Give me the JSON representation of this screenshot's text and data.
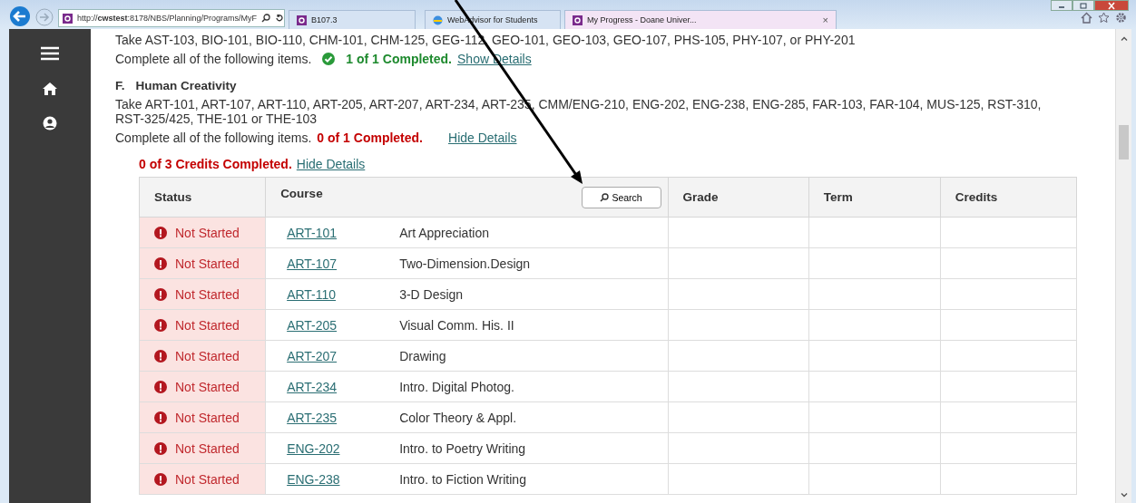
{
  "browser": {
    "url": "http://**cwstest**:8178/NBS/Planning/Programs/MyF",
    "tabs": [
      {
        "label": "B107.3",
        "selected": false
      },
      {
        "label": "WebAdvisor for Students",
        "selected": false
      },
      {
        "label": "My Progress - Doane Univer...",
        "selected": true,
        "close": "×"
      }
    ]
  },
  "previous_requirement": {
    "description": "Take AST-103, BIO-101, BIO-110, CHM-101, CHM-125, GEG-112, GEO-101, GEO-103, GEO-107, PHS-105, PHY-107, or PHY-201",
    "instruction": "Complete all of the following items.",
    "completed": true,
    "progress": "1 of 1 Completed.",
    "link": "Show Details"
  },
  "section": {
    "letter": "F.",
    "title": "Human Creativity",
    "description": "Take ART-101, ART-107, ART-110, ART-205, ART-207, ART-234, ART-235, CMM/ENG-210, ENG-202, ENG-238, ENG-285, FAR-103, FAR-104, MUS-125, RST-310, RST-325/425, THE-101 or THE-103",
    "instruction": "Complete all of the following items.",
    "completed": false,
    "progress": "0 of 1 Completed.",
    "link": "Hide Details"
  },
  "group": {
    "completed": false,
    "progress": "0 of 3 Credits Completed.",
    "link": "Hide Details"
  },
  "table": {
    "columns": [
      {
        "label": "Status"
      },
      {
        "label": "Course",
        "search_button": "Search"
      },
      {
        "label": "Grade"
      },
      {
        "label": "Term"
      },
      {
        "label": "Credits"
      }
    ],
    "rows": [
      {
        "status": "Not Started",
        "completed": false,
        "code": "ART-101",
        "title": "Art Appreciation"
      },
      {
        "status": "Not Started",
        "completed": false,
        "code": "ART-107",
        "title": "Two-Dimension.Design"
      },
      {
        "status": "Not Started",
        "completed": false,
        "code": "ART-110",
        "title": "3-D Design"
      },
      {
        "status": "Not Started",
        "completed": false,
        "code": "ART-205",
        "title": "Visual Comm. His. II"
      },
      {
        "status": "Not Started",
        "completed": false,
        "code": "ART-207",
        "title": "Drawing"
      },
      {
        "status": "Not Started",
        "completed": false,
        "code": "ART-234",
        "title": "Intro. Digital Photog."
      },
      {
        "status": "Not Started",
        "completed": false,
        "code": "ART-235",
        "title": "Color Theory & Appl."
      },
      {
        "status": "Not Started",
        "completed": false,
        "code": "ENG-202",
        "title": "Intro. to Poetry Writing"
      },
      {
        "status": "Not Started",
        "completed": false,
        "code": "ENG-238",
        "title": "Intro. to Fiction Writing"
      }
    ]
  }
}
